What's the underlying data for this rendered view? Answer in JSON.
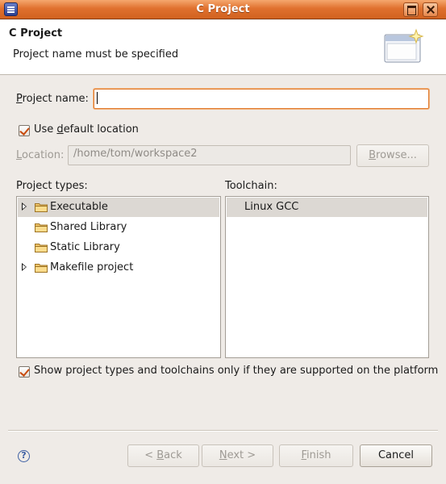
{
  "window": {
    "title": "C Project",
    "accent": "#e0712f"
  },
  "header": {
    "title": "C Project",
    "message": "Project name must be specified",
    "icon": "wizard-banner-icon"
  },
  "project_name": {
    "label_pre": "",
    "label_u": "P",
    "label_post": "roject name:",
    "value": ""
  },
  "default_location": {
    "checked": true,
    "label_pre": "Use ",
    "label_u": "d",
    "label_post": "efault location"
  },
  "location": {
    "label_u": "L",
    "label_post": "ocation:",
    "value": "/home/tom/workspace2",
    "browse_u": "B",
    "browse_post": "rowse..."
  },
  "project_types": {
    "label": "Project types:",
    "items": [
      {
        "label": "Executable",
        "expandable": true,
        "selected": true
      },
      {
        "label": "Shared Library",
        "expandable": false,
        "selected": false
      },
      {
        "label": "Static Library",
        "expandable": false,
        "selected": false
      },
      {
        "label": "Makefile project",
        "expandable": true,
        "selected": false
      }
    ]
  },
  "toolchain": {
    "label": "Toolchain:",
    "items": [
      {
        "label": "Linux GCC",
        "selected": true
      }
    ]
  },
  "filter": {
    "checked": true,
    "label": "Show project types and toolchains only if they are supported on the platform"
  },
  "footer": {
    "help_icon": "help-icon",
    "back_pre": "< ",
    "back_u": "B",
    "back_post": "ack",
    "next_u": "N",
    "next_post": "ext >",
    "finish_u": "F",
    "finish_post": "inish",
    "cancel": "Cancel"
  }
}
